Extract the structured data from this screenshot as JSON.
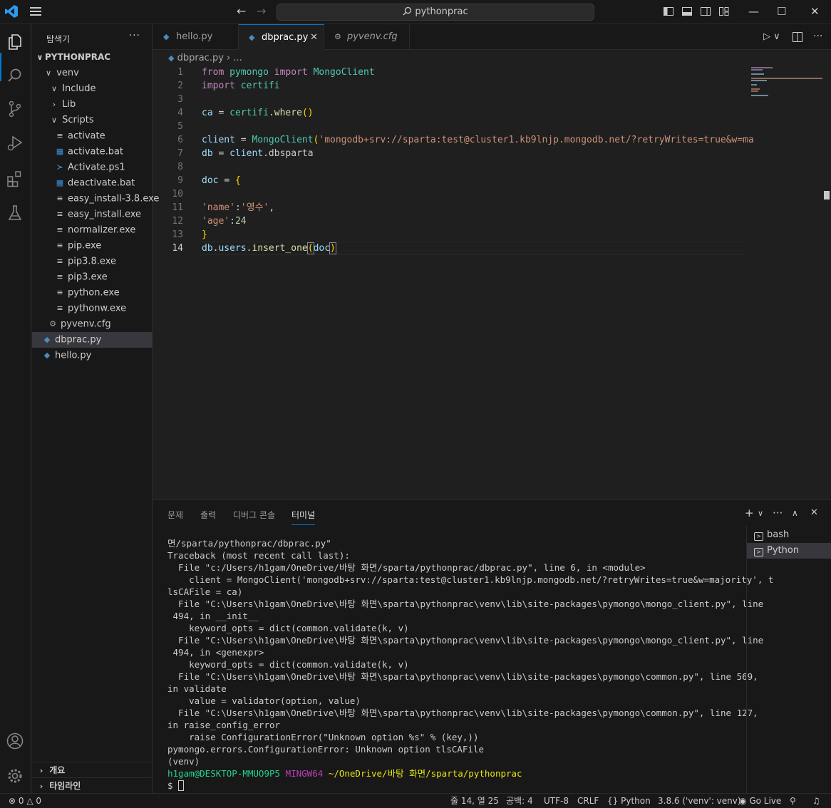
{
  "titlebar": {
    "search": "pythonprac"
  },
  "sidebar": {
    "title": "탐색기",
    "more": "···",
    "root": "PYTHONPRAC",
    "items": [
      {
        "label": "venv",
        "type": "folder-open"
      },
      {
        "label": "Include",
        "type": "folder-open"
      },
      {
        "label": "Lib",
        "type": "folder"
      },
      {
        "label": "Scripts",
        "type": "folder-open"
      },
      {
        "label": "activate",
        "type": "file"
      },
      {
        "label": "activate.bat",
        "type": "bat"
      },
      {
        "label": "Activate.ps1",
        "type": "ps1"
      },
      {
        "label": "deactivate.bat",
        "type": "bat"
      },
      {
        "label": "easy_install-3.8.exe",
        "type": "file"
      },
      {
        "label": "easy_install.exe",
        "type": "file"
      },
      {
        "label": "normalizer.exe",
        "type": "file"
      },
      {
        "label": "pip.exe",
        "type": "file"
      },
      {
        "label": "pip3.8.exe",
        "type": "file"
      },
      {
        "label": "pip3.exe",
        "type": "file"
      },
      {
        "label": "python.exe",
        "type": "file"
      },
      {
        "label": "pythonw.exe",
        "type": "file"
      },
      {
        "label": "pyvenv.cfg",
        "type": "cfg"
      },
      {
        "label": "dbprac.py",
        "type": "py"
      },
      {
        "label": "hello.py",
        "type": "py"
      }
    ],
    "outline": "개요",
    "timeline": "타임라인"
  },
  "tabs": [
    {
      "label": "hello.py"
    },
    {
      "label": "dbprac.py",
      "close": "✕"
    },
    {
      "label": "pyvenv.cfg"
    }
  ],
  "breadcrumb": {
    "file": "dbprac.py",
    "sep": "›",
    "rest": "..."
  },
  "editor": {
    "line_numbers": [
      "1",
      "2",
      "3",
      "4",
      "5",
      "6",
      "7",
      "8",
      "9",
      "10",
      "11",
      "12",
      "13",
      "14"
    ],
    "l1": {
      "a": "from",
      "b": "pymongo",
      "c": "import",
      "d": "MongoClient"
    },
    "l2": {
      "a": "import",
      "b": "certifi"
    },
    "l4": {
      "a": "ca",
      "b": "=",
      "c": "certifi",
      "d": ".",
      "e": "where",
      "f": "()"
    },
    "l6": {
      "a": "client",
      "b": "=",
      "c": "MongoClient",
      "d": "(",
      "e": "'mongodb+srv://sparta:test@cluster1.kb9lnjp.mongodb.net/?retryWrites=true&w=ma"
    },
    "l7": {
      "a": "db",
      "b": "=",
      "c": "client",
      "d": ".dbsparta"
    },
    "l9": {
      "a": "doc",
      "b": "=",
      "c": "{"
    },
    "l11": {
      "a": "'name'",
      "b": ":",
      "c": "'영수'",
      "d": ","
    },
    "l12": {
      "a": "'age'",
      "b": ":",
      "c": "24"
    },
    "l13": {
      "a": "}"
    },
    "l14": {
      "a": "db",
      "b": ".",
      "c": "users",
      "d": ".",
      "e": "insert_one",
      "f": "(",
      "g": "doc",
      "h": ")"
    }
  },
  "panel": {
    "tabs": [
      "문제",
      "출력",
      "디버그 콘솔",
      "터미널"
    ],
    "terminal_lines": [
      "면/sparta/pythonprac/dbprac.py\"",
      "Traceback (most recent call last):",
      "  File \"c:/Users/h1gam/OneDrive/바탕 화면/sparta/pythonprac/dbprac.py\", line 6, in <module>",
      "    client = MongoClient('mongodb+srv://sparta:test@cluster1.kb9lnjp.mongodb.net/?retryWrites=true&w=majority', t",
      "lsCAFile = ca)",
      "  File \"C:\\Users\\h1gam\\OneDrive\\바탕 화면\\sparta\\pythonprac\\venv\\lib\\site-packages\\pymongo\\mongo_client.py\", line",
      " 494, in __init__",
      "    keyword_opts = dict(common.validate(k, v)",
      "  File \"C:\\Users\\h1gam\\OneDrive\\바탕 화면\\sparta\\pythonprac\\venv\\lib\\site-packages\\pymongo\\mongo_client.py\", line",
      " 494, in <genexpr>",
      "    keyword_opts = dict(common.validate(k, v)",
      "  File \"C:\\Users\\h1gam\\OneDrive\\바탕 화면\\sparta\\pythonprac\\venv\\lib\\site-packages\\pymongo\\common.py\", line 569,",
      "in validate",
      "    value = validator(option, value)",
      "  File \"C:\\Users\\h1gam\\OneDrive\\바탕 화면\\sparta\\pythonprac\\venv\\lib\\site-packages\\pymongo\\common.py\", line 127,",
      "in raise_config_error",
      "    raise ConfigurationError(\"Unknown option %s\" % (key,))",
      "pymongo.errors.ConfigurationError: Unknown option tlsCAFile",
      "(venv)"
    ],
    "prompt": {
      "user": "h1gam@DESKTOP-MMUO9P5",
      "env": "MINGW64",
      "path": "~/OneDrive/바탕 화면/sparta/pythonprac",
      "symbol": "$"
    },
    "terminals": [
      "bash",
      "Python"
    ]
  },
  "statusbar": {
    "errors": "0",
    "warnings": "0",
    "position": "줄 14, 열 25",
    "spaces": "공백: 4",
    "encoding": "UTF-8",
    "eol": "CRLF",
    "language": "Python",
    "interpreter": "3.8.6 ('venv': venv)",
    "golive": "Go Live"
  }
}
